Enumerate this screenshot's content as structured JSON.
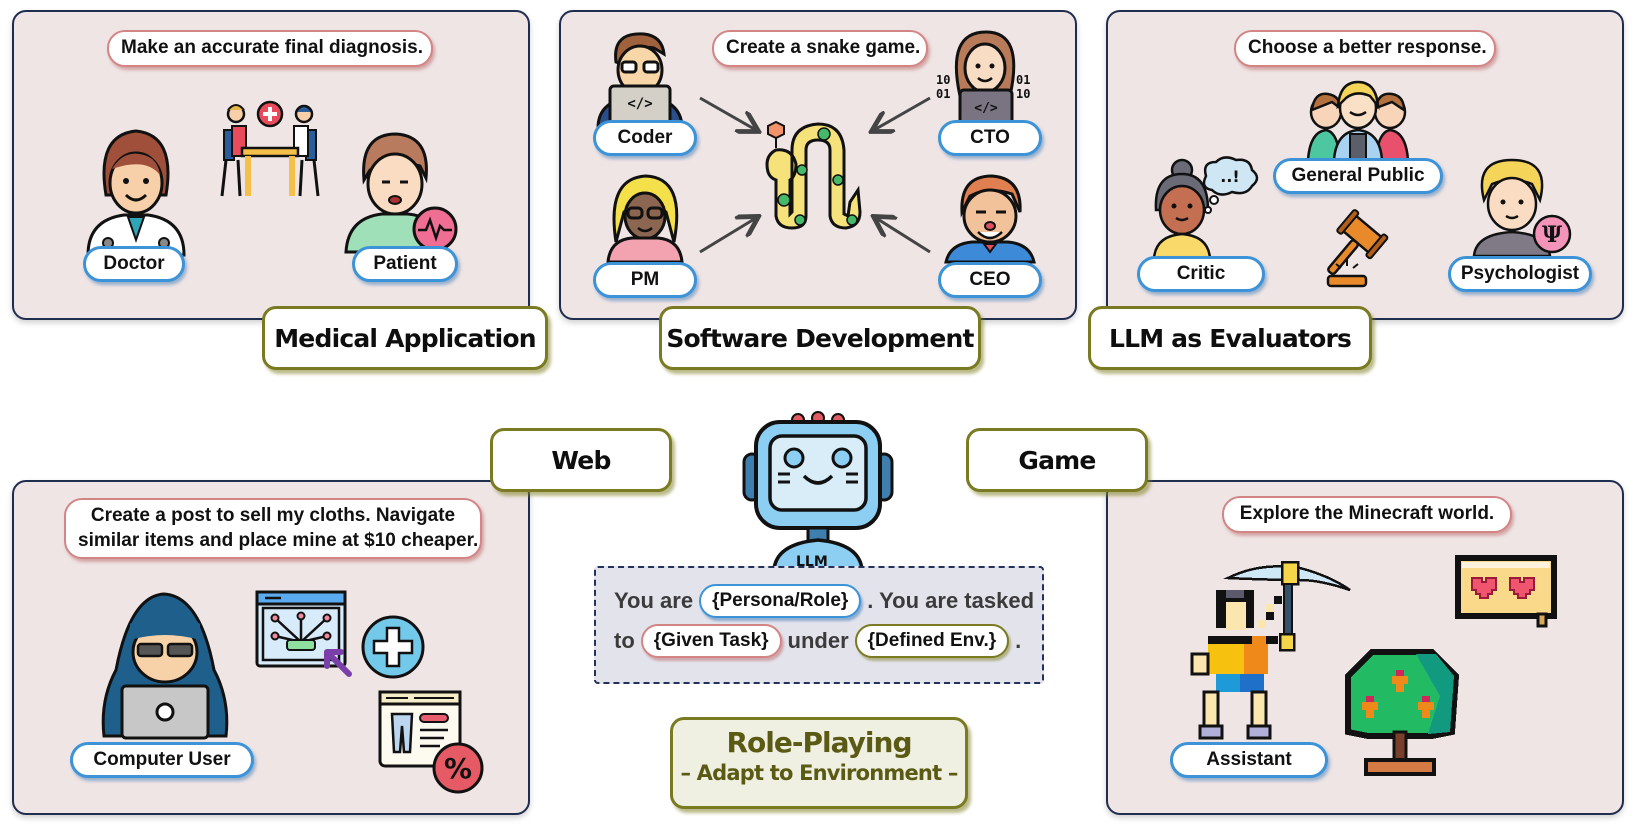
{
  "panels": {
    "medical": {
      "category": "Medical Application",
      "task": "Make an accurate final diagnosis.",
      "roles": [
        "Doctor",
        "Patient"
      ],
      "icons": [
        "doctor-icon",
        "consultation-table-icon",
        "patient-icon",
        "heartbeat-icon"
      ]
    },
    "software": {
      "category": "Software Development",
      "task": "Create a snake game.",
      "roles": [
        "Coder",
        "CTO",
        "PM",
        "CEO"
      ],
      "icons": [
        "coder-icon",
        "cto-icon",
        "pm-icon",
        "ceo-icon",
        "snake-icon",
        "arrow-icon"
      ]
    },
    "evaluators": {
      "category": "LLM as Evaluators",
      "task": "Choose a better response.",
      "roles": [
        "General Public",
        "Critic",
        "Psychologist"
      ],
      "thought_text": "..!",
      "psi_symbol": "Ψ",
      "icons": [
        "group-icon",
        "critic-icon",
        "psychologist-icon",
        "gavel-icon"
      ]
    },
    "web": {
      "category": "Web",
      "task_line1": "Create a post to sell my cloths. Navigate",
      "task_line2": "similar items and place mine at $10 cheaper.",
      "roles": [
        "Computer User"
      ],
      "percent_symbol": "%",
      "icons": [
        "hacker-laptop-icon",
        "browser-network-icon",
        "plus-circle-icon",
        "shopping-discount-icon"
      ]
    },
    "game": {
      "category": "Game",
      "task": "Explore the Minecraft world.",
      "roles": [
        "Assistant"
      ],
      "icons": [
        "pixel-miner-icon",
        "pixel-tree-icon",
        "pixel-hearts-bubble-icon"
      ]
    }
  },
  "center": {
    "robot_label": "LLM",
    "prompt": {
      "p1": "You are",
      "slot_persona": "{Persona/Role}",
      "p2": ". You are tasked",
      "p3": "to",
      "slot_task": "{Given Task}",
      "p4": "under",
      "slot_env": "{Defined Env.}",
      "p5": "."
    },
    "title": "Role-Playing",
    "subtitle": "– Adapt to Environment –"
  },
  "colors": {
    "panel_bg": "#efe5e5",
    "panel_border": "#1f2d4f",
    "task_border": "#d38585",
    "role_border": "#3d93d8",
    "category_border": "#7a7a22",
    "title_text": "#5a5a14"
  }
}
